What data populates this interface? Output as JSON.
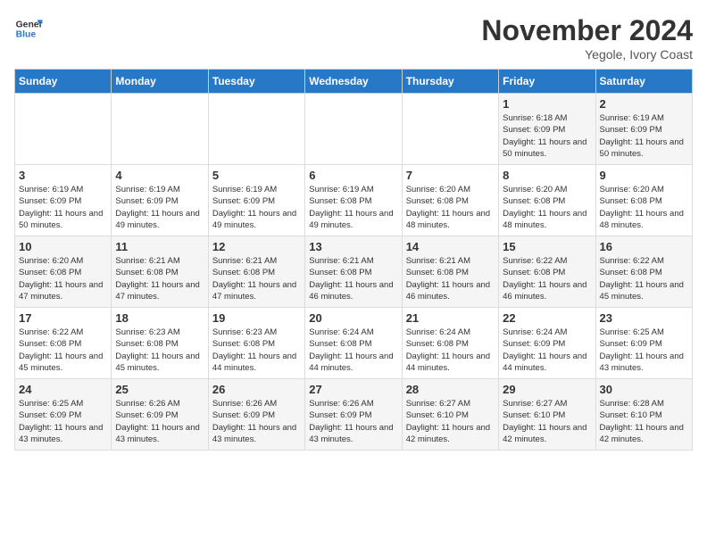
{
  "header": {
    "logo_line1": "General",
    "logo_line2": "Blue",
    "title": "November 2024",
    "subtitle": "Yegole, Ivory Coast"
  },
  "days_of_week": [
    "Sunday",
    "Monday",
    "Tuesday",
    "Wednesday",
    "Thursday",
    "Friday",
    "Saturday"
  ],
  "weeks": [
    [
      {
        "day": "",
        "content": ""
      },
      {
        "day": "",
        "content": ""
      },
      {
        "day": "",
        "content": ""
      },
      {
        "day": "",
        "content": ""
      },
      {
        "day": "",
        "content": ""
      },
      {
        "day": "1",
        "content": "Sunrise: 6:18 AM\nSunset: 6:09 PM\nDaylight: 11 hours and 50 minutes."
      },
      {
        "day": "2",
        "content": "Sunrise: 6:19 AM\nSunset: 6:09 PM\nDaylight: 11 hours and 50 minutes."
      }
    ],
    [
      {
        "day": "3",
        "content": "Sunrise: 6:19 AM\nSunset: 6:09 PM\nDaylight: 11 hours and 50 minutes."
      },
      {
        "day": "4",
        "content": "Sunrise: 6:19 AM\nSunset: 6:09 PM\nDaylight: 11 hours and 49 minutes."
      },
      {
        "day": "5",
        "content": "Sunrise: 6:19 AM\nSunset: 6:09 PM\nDaylight: 11 hours and 49 minutes."
      },
      {
        "day": "6",
        "content": "Sunrise: 6:19 AM\nSunset: 6:08 PM\nDaylight: 11 hours and 49 minutes."
      },
      {
        "day": "7",
        "content": "Sunrise: 6:20 AM\nSunset: 6:08 PM\nDaylight: 11 hours and 48 minutes."
      },
      {
        "day": "8",
        "content": "Sunrise: 6:20 AM\nSunset: 6:08 PM\nDaylight: 11 hours and 48 minutes."
      },
      {
        "day": "9",
        "content": "Sunrise: 6:20 AM\nSunset: 6:08 PM\nDaylight: 11 hours and 48 minutes."
      }
    ],
    [
      {
        "day": "10",
        "content": "Sunrise: 6:20 AM\nSunset: 6:08 PM\nDaylight: 11 hours and 47 minutes."
      },
      {
        "day": "11",
        "content": "Sunrise: 6:21 AM\nSunset: 6:08 PM\nDaylight: 11 hours and 47 minutes."
      },
      {
        "day": "12",
        "content": "Sunrise: 6:21 AM\nSunset: 6:08 PM\nDaylight: 11 hours and 47 minutes."
      },
      {
        "day": "13",
        "content": "Sunrise: 6:21 AM\nSunset: 6:08 PM\nDaylight: 11 hours and 46 minutes."
      },
      {
        "day": "14",
        "content": "Sunrise: 6:21 AM\nSunset: 6:08 PM\nDaylight: 11 hours and 46 minutes."
      },
      {
        "day": "15",
        "content": "Sunrise: 6:22 AM\nSunset: 6:08 PM\nDaylight: 11 hours and 46 minutes."
      },
      {
        "day": "16",
        "content": "Sunrise: 6:22 AM\nSunset: 6:08 PM\nDaylight: 11 hours and 45 minutes."
      }
    ],
    [
      {
        "day": "17",
        "content": "Sunrise: 6:22 AM\nSunset: 6:08 PM\nDaylight: 11 hours and 45 minutes."
      },
      {
        "day": "18",
        "content": "Sunrise: 6:23 AM\nSunset: 6:08 PM\nDaylight: 11 hours and 45 minutes."
      },
      {
        "day": "19",
        "content": "Sunrise: 6:23 AM\nSunset: 6:08 PM\nDaylight: 11 hours and 44 minutes."
      },
      {
        "day": "20",
        "content": "Sunrise: 6:24 AM\nSunset: 6:08 PM\nDaylight: 11 hours and 44 minutes."
      },
      {
        "day": "21",
        "content": "Sunrise: 6:24 AM\nSunset: 6:08 PM\nDaylight: 11 hours and 44 minutes."
      },
      {
        "day": "22",
        "content": "Sunrise: 6:24 AM\nSunset: 6:09 PM\nDaylight: 11 hours and 44 minutes."
      },
      {
        "day": "23",
        "content": "Sunrise: 6:25 AM\nSunset: 6:09 PM\nDaylight: 11 hours and 43 minutes."
      }
    ],
    [
      {
        "day": "24",
        "content": "Sunrise: 6:25 AM\nSunset: 6:09 PM\nDaylight: 11 hours and 43 minutes."
      },
      {
        "day": "25",
        "content": "Sunrise: 6:26 AM\nSunset: 6:09 PM\nDaylight: 11 hours and 43 minutes."
      },
      {
        "day": "26",
        "content": "Sunrise: 6:26 AM\nSunset: 6:09 PM\nDaylight: 11 hours and 43 minutes."
      },
      {
        "day": "27",
        "content": "Sunrise: 6:26 AM\nSunset: 6:09 PM\nDaylight: 11 hours and 43 minutes."
      },
      {
        "day": "28",
        "content": "Sunrise: 6:27 AM\nSunset: 6:10 PM\nDaylight: 11 hours and 42 minutes."
      },
      {
        "day": "29",
        "content": "Sunrise: 6:27 AM\nSunset: 6:10 PM\nDaylight: 11 hours and 42 minutes."
      },
      {
        "day": "30",
        "content": "Sunrise: 6:28 AM\nSunset: 6:10 PM\nDaylight: 11 hours and 42 minutes."
      }
    ]
  ]
}
